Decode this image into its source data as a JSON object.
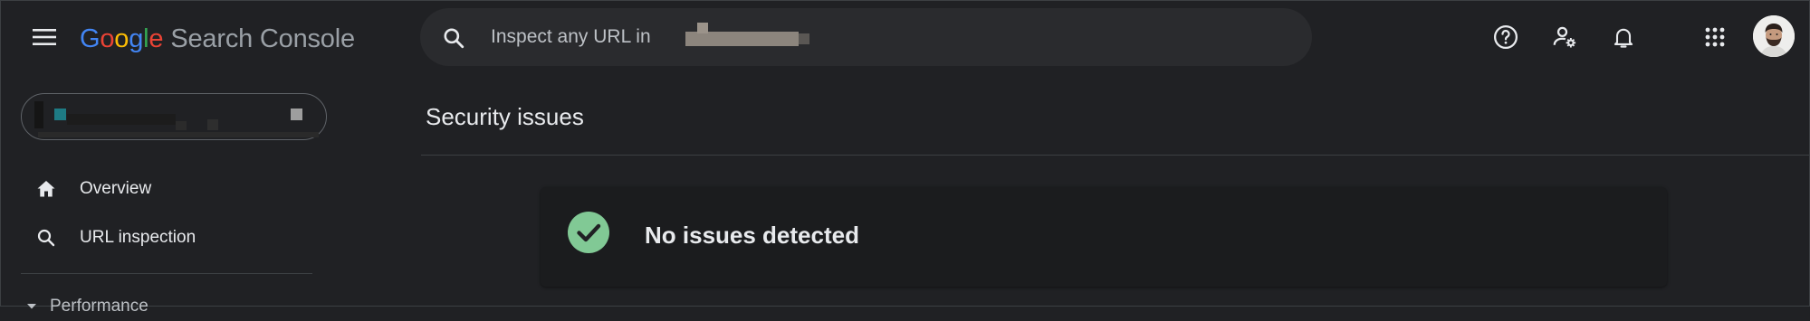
{
  "header": {
    "logo_google": [
      "G",
      "o",
      "o",
      "g",
      "l",
      "e"
    ],
    "logo_product": "Search Console",
    "search_placeholder": "Inspect any URL in",
    "icons": [
      "menu-icon",
      "search-icon",
      "help-icon",
      "manage-users-icon",
      "notifications-icon",
      "apps-icon"
    ]
  },
  "sidebar": {
    "items": [
      {
        "label": "Overview",
        "icon": "home-icon"
      },
      {
        "label": "URL inspection",
        "icon": "search-icon"
      }
    ],
    "section": {
      "label": "Performance",
      "icon": "collapse-arrow-icon"
    }
  },
  "main": {
    "title": "Security issues",
    "status_message": "No issues detected",
    "status_icon": "check-circle-icon"
  },
  "colors": {
    "background": "#202124",
    "success": "#81c995",
    "text": "#e8eaed"
  }
}
